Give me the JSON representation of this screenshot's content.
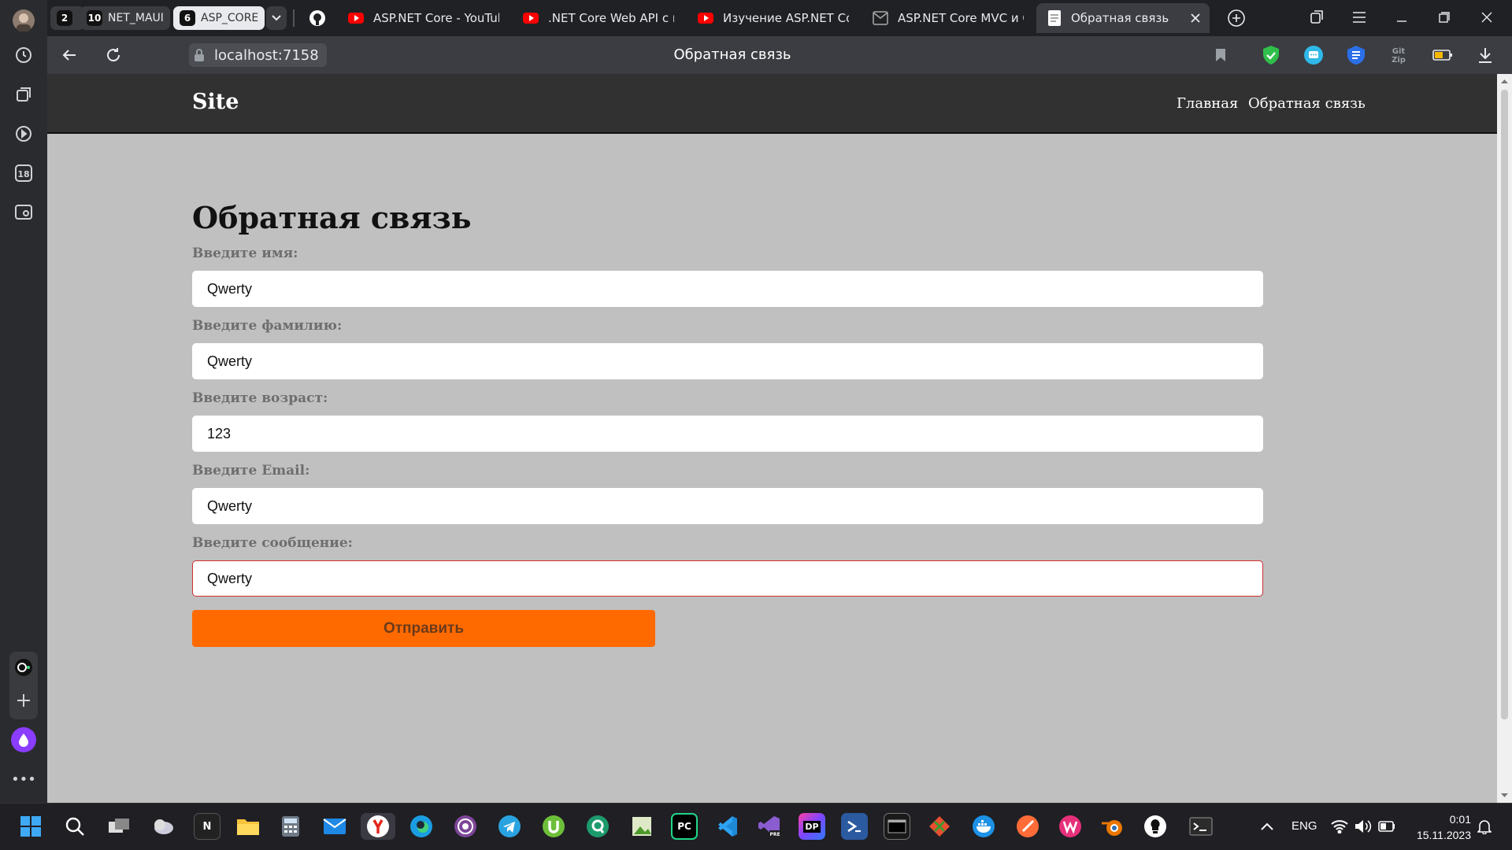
{
  "browser": {
    "tab_groups": [
      {
        "count": "2",
        "label": ""
      },
      {
        "count": "10",
        "label": "NET_MAUI"
      },
      {
        "count": "6",
        "label": "ASP_CORE"
      }
    ],
    "tabs": [
      {
        "title": "ASP.NET Core - YouTube"
      },
      {
        "title": ".NET Core Web API с нуля"
      },
      {
        "title": "Изучение ASP.NET Core"
      },
      {
        "title": "ASP.NET Core MVC и C#"
      },
      {
        "title": "Обратная связь"
      }
    ],
    "url": "localhost:7158",
    "page_title": "Обратная связь",
    "sidebar_badge": "18"
  },
  "site": {
    "brand": "Site",
    "nav": [
      "Главная",
      "Обратная связь"
    ]
  },
  "form": {
    "title": "Обратная связь",
    "fields": [
      {
        "label": "Введите имя:",
        "value": "Qwerty"
      },
      {
        "label": "Введите фамилию:",
        "value": "Qwerty"
      },
      {
        "label": "Введите возраст:",
        "value": "123"
      },
      {
        "label": "Введите Email:",
        "value": "Qwerty"
      },
      {
        "label": "Введите сообщение:",
        "value": "Qwerty"
      }
    ],
    "submit_label": "Отправить",
    "accent": "#ff6a00",
    "error_border": "#d32f2f"
  },
  "taskbar": {
    "language": "ENG",
    "time": "0:01",
    "date": "15.11.2023"
  }
}
